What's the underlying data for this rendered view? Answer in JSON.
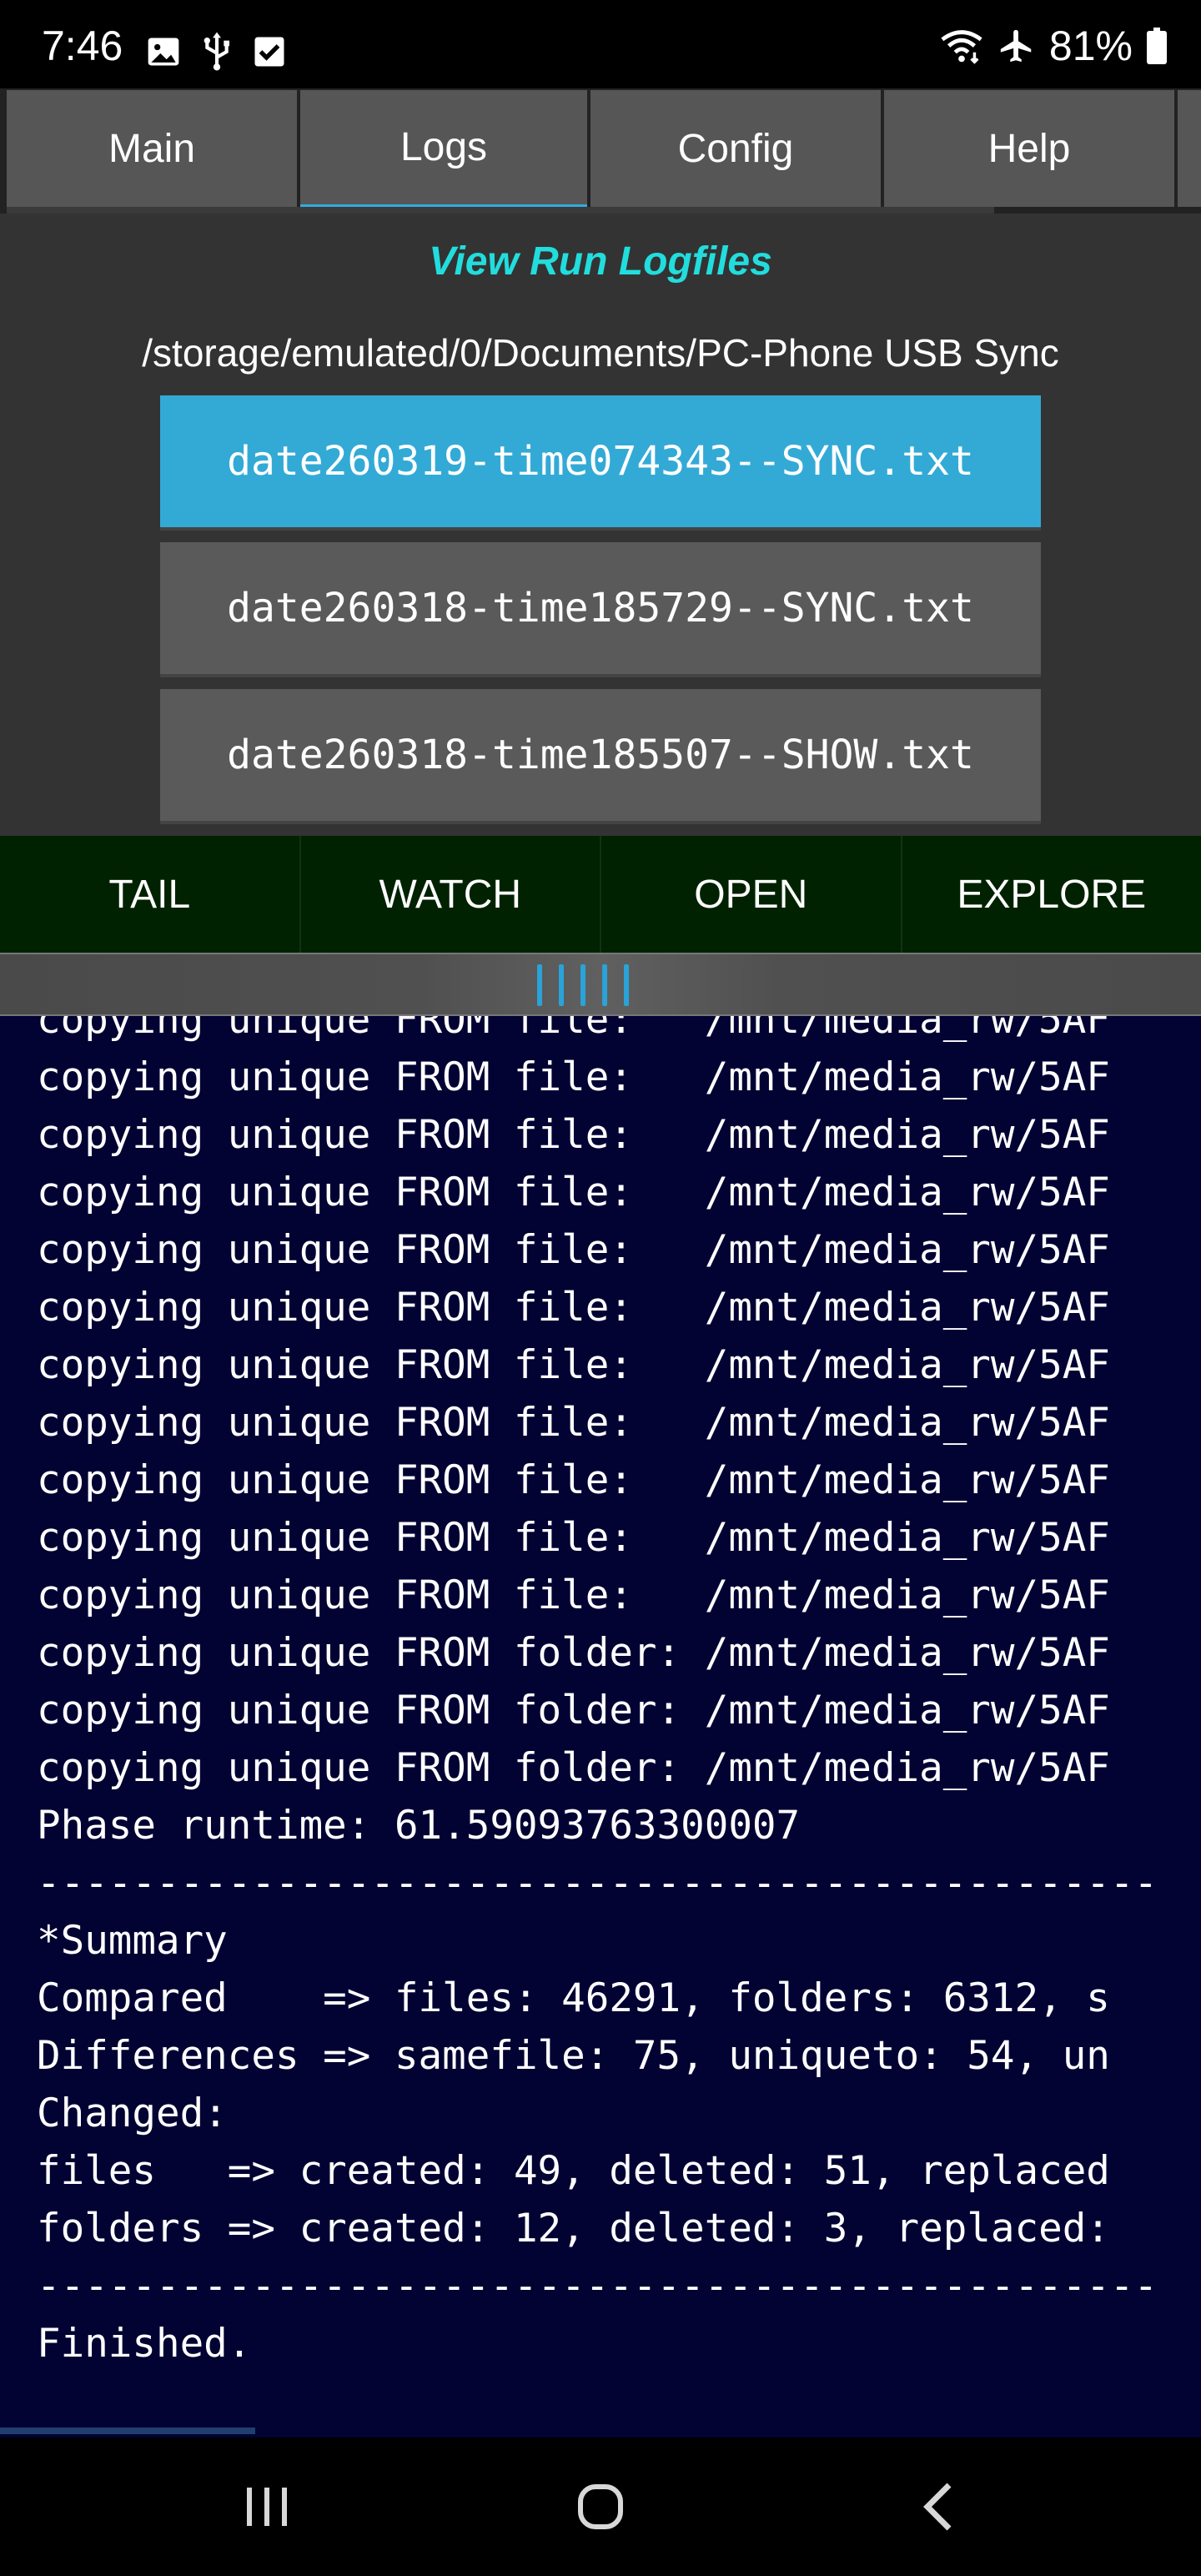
{
  "status_bar": {
    "time": "7:46",
    "icons_left": [
      "image-icon",
      "usb-icon",
      "checkbox-icon"
    ],
    "icons_right": [
      "wifi-icon",
      "airplane-icon"
    ],
    "battery_pct": "81%"
  },
  "tabs": [
    {
      "label": "Main",
      "active": false
    },
    {
      "label": "Logs",
      "active": true
    },
    {
      "label": "Config",
      "active": false
    },
    {
      "label": "Help",
      "active": false
    }
  ],
  "logs": {
    "title": "View Run Logfiles",
    "path": "/storage/emulated/0/Documents/PC-Phone USB Sync",
    "files": [
      {
        "name": "date260319-time074343--SYNC.txt",
        "selected": true
      },
      {
        "name": "date260318-time185729--SYNC.txt",
        "selected": false
      },
      {
        "name": "date260318-time185507--SHOW.txt",
        "selected": false
      }
    ]
  },
  "actions": [
    {
      "label": "TAIL"
    },
    {
      "label": "WATCH"
    },
    {
      "label": "OPEN"
    },
    {
      "label": "EXPLORE"
    }
  ],
  "log_output": [
    "copying unique FROM file:   /mnt/media_rw/5AF",
    "copying unique FROM file:   /mnt/media_rw/5AF",
    "copying unique FROM file:   /mnt/media_rw/5AF",
    "copying unique FROM file:   /mnt/media_rw/5AF",
    "copying unique FROM file:   /mnt/media_rw/5AF",
    "copying unique FROM file:   /mnt/media_rw/5AF",
    "copying unique FROM file:   /mnt/media_rw/5AF",
    "copying unique FROM file:   /mnt/media_rw/5AF",
    "copying unique FROM file:   /mnt/media_rw/5AF",
    "copying unique FROM file:   /mnt/media_rw/5AF",
    "copying unique FROM folder: /mnt/media_rw/5AF",
    "copying unique FROM folder: /mnt/media_rw/5AF",
    "copying unique FROM folder: /mnt/media_rw/5AF",
    "Phase runtime: 61.59093763300007",
    "-----------------------------------------------",
    "*Summary",
    "Compared    => files: 46291, folders: 6312, s",
    "Differences => samefile: 75, uniqueto: 54, un",
    "Changed:",
    "files   => created: 49, deleted: 51, replaced",
    "folders => created: 12, deleted: 3, replaced:",
    "-----------------------------------------------",
    "Finished."
  ],
  "nav": [
    "recents-icon",
    "home-icon",
    "back-icon"
  ],
  "colors": {
    "accent": "#33aad6",
    "title": "#22dddd",
    "action_bg": "#002200",
    "log_bg": "#020233"
  }
}
